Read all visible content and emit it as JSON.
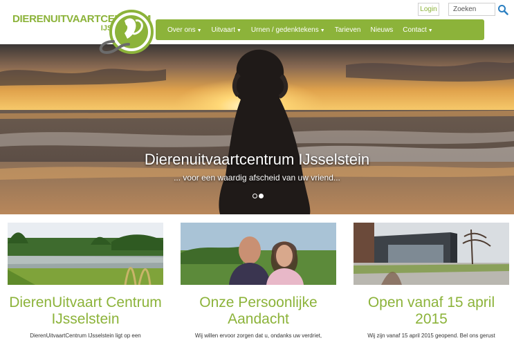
{
  "brand": {
    "line1": "DIERENUITVAARTCENTRUM",
    "line2": "IJSSELSTEIN",
    "accent_color": "#8cb33a"
  },
  "header": {
    "login_label": "Login",
    "search_placeholder": "Zoeken",
    "search_icon": "search-icon"
  },
  "nav": {
    "items": [
      {
        "label": "Over ons",
        "has_dropdown": true
      },
      {
        "label": "Uitvaart",
        "has_dropdown": true
      },
      {
        "label": "Urnen / gedenktekens",
        "has_dropdown": true
      },
      {
        "label": "Tarieven",
        "has_dropdown": false
      },
      {
        "label": "Nieuws",
        "has_dropdown": false
      },
      {
        "label": "Contact",
        "has_dropdown": true
      }
    ]
  },
  "hero": {
    "title": "Dierenuitvaartcentrum IJsselstein",
    "subtitle": "... voor een waardig afscheid van uw vriend...",
    "active_slide": 2,
    "slide_count": 2
  },
  "columns": [
    {
      "title": "DierenUitvaart Centrum IJsselstein",
      "text": "DierenUitvaartCentrum IJsselstein ligt op een"
    },
    {
      "title": "Onze Persoonlijke Aandacht",
      "text": "Wij willen ervoor zorgen dat u, ondanks uw verdriet,"
    },
    {
      "title": "Open vanaf 15 april 2015",
      "text": "Wij zijn vanaf 15 april 2015 geopend. Bel ons gerust"
    }
  ]
}
